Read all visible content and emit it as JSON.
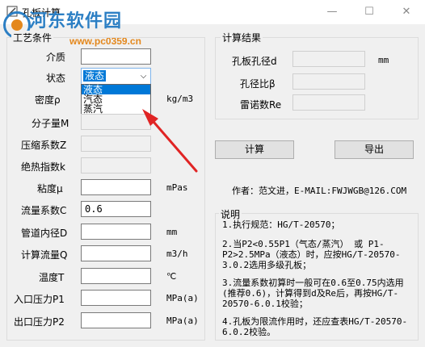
{
  "window": {
    "title": "孔板计算",
    "minimize": "—",
    "maximize": "☐",
    "close": "✕"
  },
  "watermark": {
    "name": "河东软件园",
    "url": "www.pc0359.cn"
  },
  "params": {
    "legend": "工艺条件",
    "medium": {
      "label": "介质",
      "value": ""
    },
    "state": {
      "label": "状态",
      "value": "液态",
      "options": [
        "液态",
        "汽态",
        "蒸汽"
      ]
    },
    "density": {
      "label": "密度ρ",
      "unit": "kg/m3"
    },
    "molweight": {
      "label": "分子量M"
    },
    "compress": {
      "label": "压缩系数Z"
    },
    "adiabatic": {
      "label": "绝热指数k"
    },
    "viscosity": {
      "label": "粘度μ",
      "unit": "mPas"
    },
    "flowcoef": {
      "label": "流量系数C",
      "value": "0.6"
    },
    "pipediam": {
      "label": "管道内径D",
      "unit": "mm"
    },
    "flow": {
      "label": "计算流量Q",
      "unit": "m3/h"
    },
    "temp": {
      "label": "温度T",
      "unit": "℃"
    },
    "inlet": {
      "label": "入口压力P1",
      "unit": "MPa(a)"
    },
    "outlet": {
      "label": "出口压力P2",
      "unit": "MPa(a)"
    }
  },
  "results": {
    "legend": "计算结果",
    "bore": {
      "label": "孔板孔径d",
      "unit": "mm"
    },
    "beta": {
      "label": "孔径比β"
    },
    "reynolds": {
      "label": "雷诺数Re"
    }
  },
  "buttons": {
    "calc": "计算",
    "export": "导出"
  },
  "author": "作者：范文进，E-MAIL:FWJWGB@126.COM",
  "notes": {
    "legend": "说明",
    "n1": "1.执行规范：HG/T-20570；",
    "n2": "2.当P2<0.55P1（气态/蒸汽） 或  P1-P2>2.5MPa（液态）时，应按HG/T-20570-3.0.2选用多级孔板；",
    "n3": "3.流量系数初算时一般可在0.6至0.75内选用(推荐0.6)，计算得到d及Re后，再按HG/T-20570-6.0.1校验；",
    "n4": "4.孔板为限流作用时，还应查表HG/T-20570-6.0.2校验。"
  },
  "colors": {
    "accent": "#0078d7",
    "arrow": "#e02424",
    "watermark": "#2c7fc4"
  }
}
